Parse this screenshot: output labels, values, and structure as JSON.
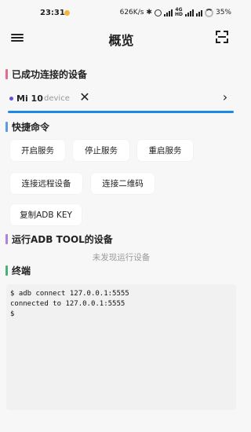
{
  "status_bar": {
    "time": "23:31",
    "net_speed": "626K/s",
    "battery": "35%",
    "bluetooth_icon": "bluetooth-icon",
    "alarm_icon": "alarm-icon",
    "wifi_icon": "wifi-icon",
    "signal_label": "4G",
    "hd_label": "HD"
  },
  "app_bar": {
    "title": "概览",
    "menu_icon": "menu-icon",
    "scan_icon": "scan-icon"
  },
  "sections": {
    "connected": "已成功连接的设备",
    "quick_commands": "快捷命令",
    "adb_tool_devices": "运行ADB TOOL的设备",
    "terminal": "终端"
  },
  "colors": {
    "connected_bar": "#e26d8b",
    "quick_bar": "#5b9be6",
    "adb_bar": "#b07fe0",
    "terminal_bar": "#4caf7a",
    "accent_underline": "#1e88e5",
    "device_dot": "#6b4bd8"
  },
  "device": {
    "name": "Mi 10",
    "status": "device",
    "close_icon": "close-icon",
    "arrow_icon": "chevron-right-icon"
  },
  "commands": {
    "start_service": "开启服务",
    "stop_service": "停止服务",
    "restart_service": "重启服务",
    "connect_remote": "连接远程设备",
    "connect_qr": "连接二维码",
    "copy_adb_key": "复制ADB KEY"
  },
  "adb_tool": {
    "empty": "未发现运行设备"
  },
  "terminal": {
    "lines": [
      "$ adb connect 127.0.0.1:5555",
      "connected to 127.0.0.1:5555",
      "$"
    ]
  }
}
